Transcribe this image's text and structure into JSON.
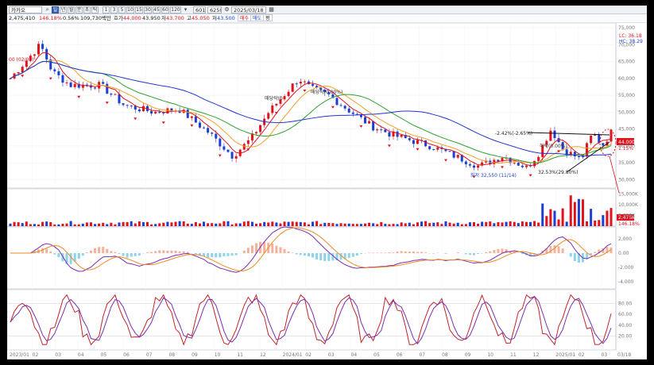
{
  "toolbar": {
    "stock_name": "카카오",
    "period_buttons": [
      "일",
      "년",
      "월",
      "분",
      "초",
      "틱"
    ],
    "minute_buttons": [
      "1",
      "3",
      "5",
      "10",
      "15",
      "30",
      "45",
      "60",
      "120"
    ],
    "count_value": "601",
    "ratio_value": "6250",
    "date_value": "2025/03/18"
  },
  "quote": {
    "volume_partial": "2,475,410",
    "change": "146.18%",
    "rate": "0.56%",
    "amount": "109,730백만",
    "ask_label": "호가",
    "ask_value": "44.000",
    "price_value": "43.950",
    "low_label": "저",
    "low_value": "43.700",
    "high_label": "고",
    "high_value": "45.050",
    "close_label": "저",
    "close_value": "43.500",
    "buy_label": "매수",
    "sell_label": "매도",
    "eval_label": "평"
  },
  "price_panel": {
    "legend_lc": "LC: 36.18",
    "legend_hc": "HC: 38.29",
    "current_price_tag": "44.000",
    "current_pct_tag": "1.15%",
    "y_ticks": [
      "75,000",
      "70,000",
      "65,000",
      "60,000",
      "55,000",
      "50,000",
      "45,000",
      "40,000",
      "35,000",
      "30,000"
    ],
    "annotations": {
      "high_label": "00 (02/09)",
      "peak_label_1": "매당락(0",
      "peak_label_2": "배당락(0.00%)",
      "low_label": "최저 32,550 (11/14)",
      "rebound_label": "하락(0.00%)",
      "trendline_top": "-2.42%(-2.65%)",
      "trendline_bottom": "32.53%(29.80%)"
    }
  },
  "volume_panel": {
    "y_ticks": [
      "15,000K",
      "10,000K",
      "5,000K"
    ],
    "vol_tag": "2,475K",
    "vol_pct_tag": "146.18%"
  },
  "macd_panel": {
    "y_ticks": [
      "2,000",
      "0.00",
      "-2,000",
      "-4,000"
    ]
  },
  "stoch_panel": {
    "y_ticks": [
      "80.00",
      "60.00",
      "40.00",
      "20.00"
    ]
  },
  "x_axis": {
    "labels": [
      "2023/01",
      "02",
      "03",
      "04",
      "05",
      "06",
      "07",
      "08",
      "09",
      "10",
      "11",
      "12",
      "2024/01",
      "02",
      "03",
      "04",
      "05",
      "06",
      "07",
      "08",
      "09",
      "10",
      "11",
      "12",
      "2025/01",
      "02",
      "03",
      "03/18"
    ]
  },
  "colors": {
    "up": "#e0121b",
    "down": "#1b3fd1",
    "ma_long": "#2433d6",
    "ma_mid": "#2ca02c",
    "ma_short": "#f0a22a",
    "ma_fast": "#e0121b"
  }
}
